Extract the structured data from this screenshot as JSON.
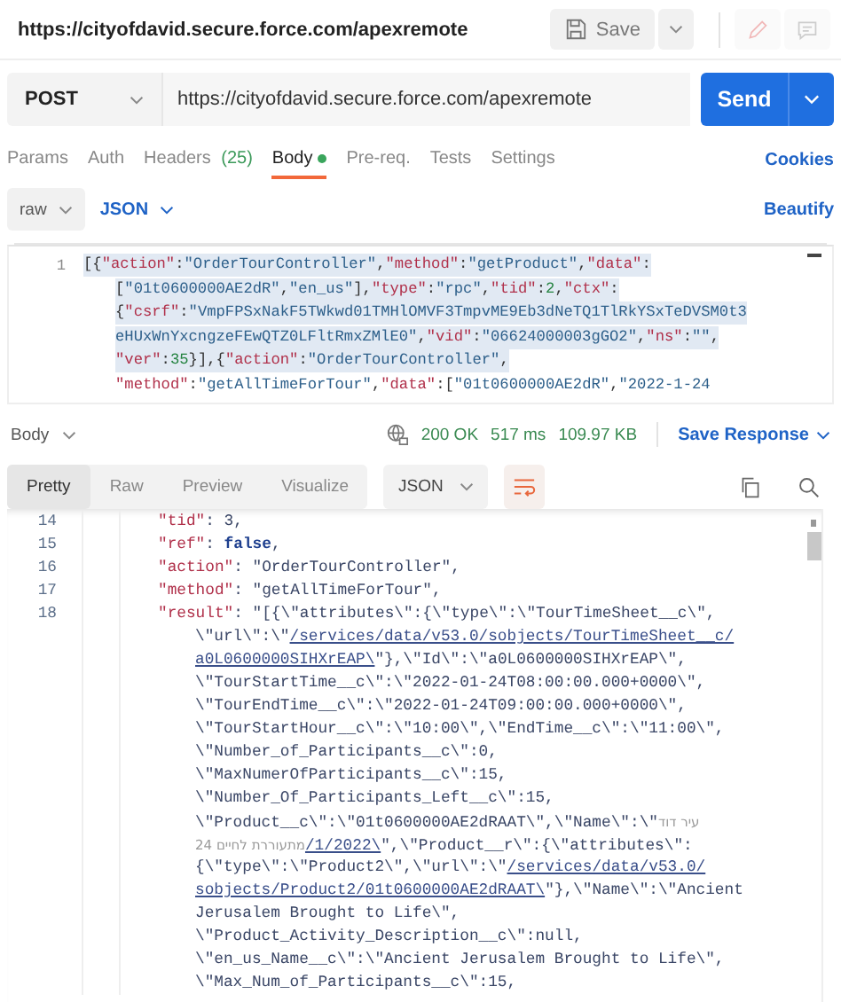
{
  "header": {
    "title": "https://cityofdavid.secure.force.com/apexremote",
    "save_label": "Save"
  },
  "request": {
    "method": "POST",
    "url": "https://cityofdavid.secure.force.com/apexremote",
    "send_label": "Send"
  },
  "request_tabs": [
    {
      "label": "Params",
      "selected": false,
      "has_content": false
    },
    {
      "label": "Auth",
      "selected": false,
      "has_content": false
    },
    {
      "label": "Headers",
      "count": "(25)",
      "selected": false,
      "has_content": false
    },
    {
      "label": "Body",
      "selected": true,
      "has_content": true
    },
    {
      "label": "Pre-req.",
      "selected": false,
      "has_content": false
    },
    {
      "label": "Tests",
      "selected": false,
      "has_content": false
    },
    {
      "label": "Settings",
      "selected": false,
      "has_content": false
    }
  ],
  "cookies_link": "Cookies",
  "body_options": {
    "mode": "raw",
    "format": "JSON",
    "beautify": "Beautify"
  },
  "request_body": {
    "lines": [
      {
        "kind": "line",
        "number": "1",
        "selected": true,
        "parts": [
          {
            "kind": "code",
            "text": "[{\"action\":\"OrderTourController\",\"method\":\"getProduct\",\"data\":"
          }
        ]
      },
      {
        "kind": "wrap",
        "selected": true,
        "parts": [
          {
            "kind": "code",
            "text": "[\"01t0600000AE2dR\",\"en_us\"],\"type\":\"rpc\",\"tid\":2,\"ctx\":"
          }
        ]
      },
      {
        "kind": "wrap",
        "selected": true,
        "parts": [
          {
            "kind": "code",
            "text": "{\"csrf\":\"VmpFPSxNakF5TWkwd01TMHlOMVF3TmpvME9Eb3dNeTQ1TlRkYSxTeDVSM0t3"
          }
        ]
      },
      {
        "kind": "wrap",
        "selected": true,
        "parts": [
          {
            "kind": "code",
            "text": "eHUxWnYxcngzeFEwQTZ0LFltRmxZMlE0\",\"vid\":\"06624000003gGO2\",\"ns\":\"\","
          }
        ]
      },
      {
        "kind": "wrap",
        "selected": true,
        "parts": [
          {
            "kind": "code",
            "text": "\"ver\":35}],{\"action\":\"OrderTourController\","
          }
        ]
      },
      {
        "kind": "wrap",
        "selected": false,
        "parts": [
          {
            "kind": "code",
            "text": "\"method\":\"getAllTimeForTour\",\"data\":[\"01t0600000AE2dR\",\"2022-1-24"
          }
        ]
      }
    ]
  },
  "response": {
    "body_label": "Body",
    "status": "200 OK",
    "time": "517 ms",
    "size": "109.97 KB",
    "save_response": "Save Response",
    "view_tabs": [
      {
        "label": "Pretty",
        "selected": true
      },
      {
        "label": "Raw",
        "selected": false
      },
      {
        "label": "Preview",
        "selected": false
      },
      {
        "label": "Visualize",
        "selected": false
      }
    ],
    "format": "JSON",
    "wrap_lines": true,
    "lines": [
      {
        "kind": "line",
        "number": "14",
        "parts": [
          {
            "kind": "code",
            "text": "\"tid\": 3,"
          }
        ]
      },
      {
        "kind": "line",
        "number": "15",
        "parts": [
          {
            "kind": "code",
            "text": "\"ref\": false,"
          }
        ]
      },
      {
        "kind": "line",
        "number": "16",
        "parts": [
          {
            "kind": "code",
            "text": "\"action\": \"OrderTourController\","
          }
        ]
      },
      {
        "kind": "line",
        "number": "17",
        "parts": [
          {
            "kind": "code",
            "text": "\"method\": \"getAllTimeForTour\","
          }
        ]
      },
      {
        "kind": "line",
        "number": "18",
        "parts": [
          {
            "kind": "code",
            "text": "\"result\": \"[{\\\"attributes\\\":{\\\"type\\\":\\\"TourTimeSheet__c\\\","
          }
        ]
      },
      {
        "kind": "wrap",
        "parts": [
          {
            "kind": "code",
            "text": "\\\"url\\\":\\\""
          },
          {
            "kind": "link",
            "text": "/services/data/v53.0/sobjects/TourTimeSheet__c/"
          }
        ]
      },
      {
        "kind": "wrap",
        "parts": [
          {
            "kind": "link",
            "text": "a0L0600000SIHXrEAP\\"
          },
          {
            "kind": "code",
            "text": "\"},\\\"Id\\\":\\\"a0L0600000SIHXrEAP\\\","
          }
        ]
      },
      {
        "kind": "wrap",
        "parts": [
          {
            "kind": "code",
            "text": "\\\"TourStartTime__c\\\":\\\"2022-01-24T08:00:00.000+0000\\\","
          }
        ]
      },
      {
        "kind": "wrap",
        "parts": [
          {
            "kind": "code",
            "text": "\\\"TourEndTime__c\\\":\\\"2022-01-24T09:00:00.000+0000\\\","
          }
        ]
      },
      {
        "kind": "wrap",
        "parts": [
          {
            "kind": "code",
            "text": "\\\"TourStartHour__c\\\":\\\"10:00\\\",\\\"EndTime__c\\\":\\\"11:00\\\","
          }
        ]
      },
      {
        "kind": "wrap",
        "parts": [
          {
            "kind": "code",
            "text": "\\\"Number_of_Participants__c\\\":0,"
          }
        ]
      },
      {
        "kind": "wrap",
        "parts": [
          {
            "kind": "code",
            "text": "\\\"MaxNumerOfParticipants__c\\\":15,"
          }
        ]
      },
      {
        "kind": "wrap",
        "parts": [
          {
            "kind": "code",
            "text": "\\\"Number_Of_Participants_Left__c\\\":15,"
          }
        ]
      },
      {
        "kind": "wrap",
        "parts": [
          {
            "kind": "code",
            "text": "\\\"Product__c\\\":\\\"01t0600000AE2dRAAT\\\",\\\"Name\\\":\\\""
          },
          {
            "kind": "foreign",
            "text": "עיר דוד"
          }
        ]
      },
      {
        "kind": "wrap",
        "parts": [
          {
            "kind": "foreign",
            "text": "24 מתעוררת לחיים"
          },
          {
            "kind": "link",
            "text": "/1/2022\\"
          },
          {
            "kind": "code",
            "text": "\",\\\"Product__r\\\":{\\\"attributes\\\":"
          }
        ]
      },
      {
        "kind": "wrap",
        "parts": [
          {
            "kind": "code",
            "text": "{\\\"type\\\":\\\"Product2\\\",\\\"url\\\":\\\""
          },
          {
            "kind": "link",
            "text": "/services/data/v53.0/"
          }
        ]
      },
      {
        "kind": "wrap",
        "parts": [
          {
            "kind": "link",
            "text": "sobjects/Product2/01t0600000AE2dRAAT\\"
          },
          {
            "kind": "code",
            "text": "\"},\\\"Name\\\":\\\"Ancient"
          }
        ]
      },
      {
        "kind": "wrap",
        "parts": [
          {
            "kind": "code",
            "text": "Jerusalem Brought to Life\\\","
          }
        ]
      },
      {
        "kind": "wrap",
        "parts": [
          {
            "kind": "code",
            "text": "\\\"Product_Activity_Description__c\\\":null,"
          }
        ]
      },
      {
        "kind": "wrap",
        "parts": [
          {
            "kind": "code",
            "text": "\\\"en_us_Name__c\\\":\\\"Ancient Jerusalem Brought to Life\\\","
          }
        ]
      },
      {
        "kind": "wrap",
        "parts": [
          {
            "kind": "code",
            "text": "\\\"Max_Num_of_Participants__c\\\":15,"
          }
        ]
      }
    ]
  }
}
